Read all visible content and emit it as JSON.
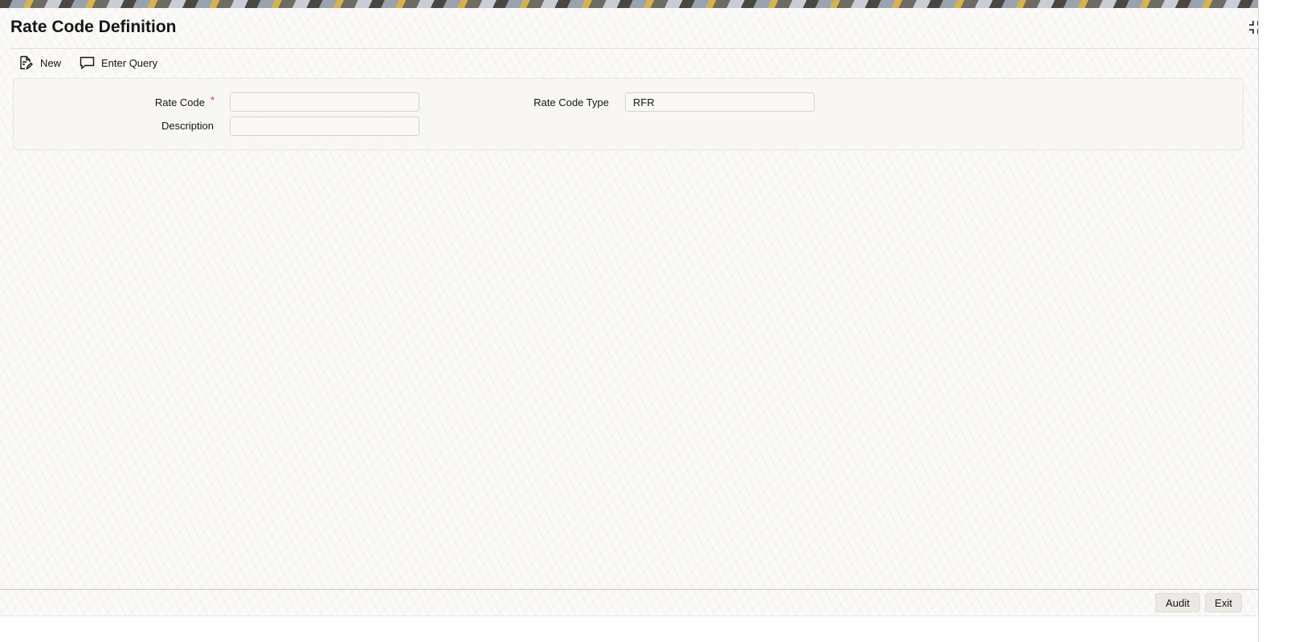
{
  "window": {
    "title": "Rate Code Definition"
  },
  "toolbar": {
    "new_label": "New",
    "enter_query_label": "Enter Query"
  },
  "form": {
    "rate_code": {
      "label": "Rate Code",
      "required_marker": "*",
      "value": ""
    },
    "description": {
      "label": "Description",
      "value": ""
    },
    "rate_code_type": {
      "label": "Rate Code Type",
      "value": "RFR"
    }
  },
  "footer": {
    "audit_label": "Audit",
    "exit_label": "Exit"
  },
  "icons": {
    "new": "document-edit-icon",
    "enter_query": "speech-bubble-icon",
    "maximize": "collapse-corners-icon",
    "close": "close-icon"
  },
  "colors": {
    "required": "#c74634",
    "text": "#161513",
    "panel_border": "#e6e3de"
  }
}
